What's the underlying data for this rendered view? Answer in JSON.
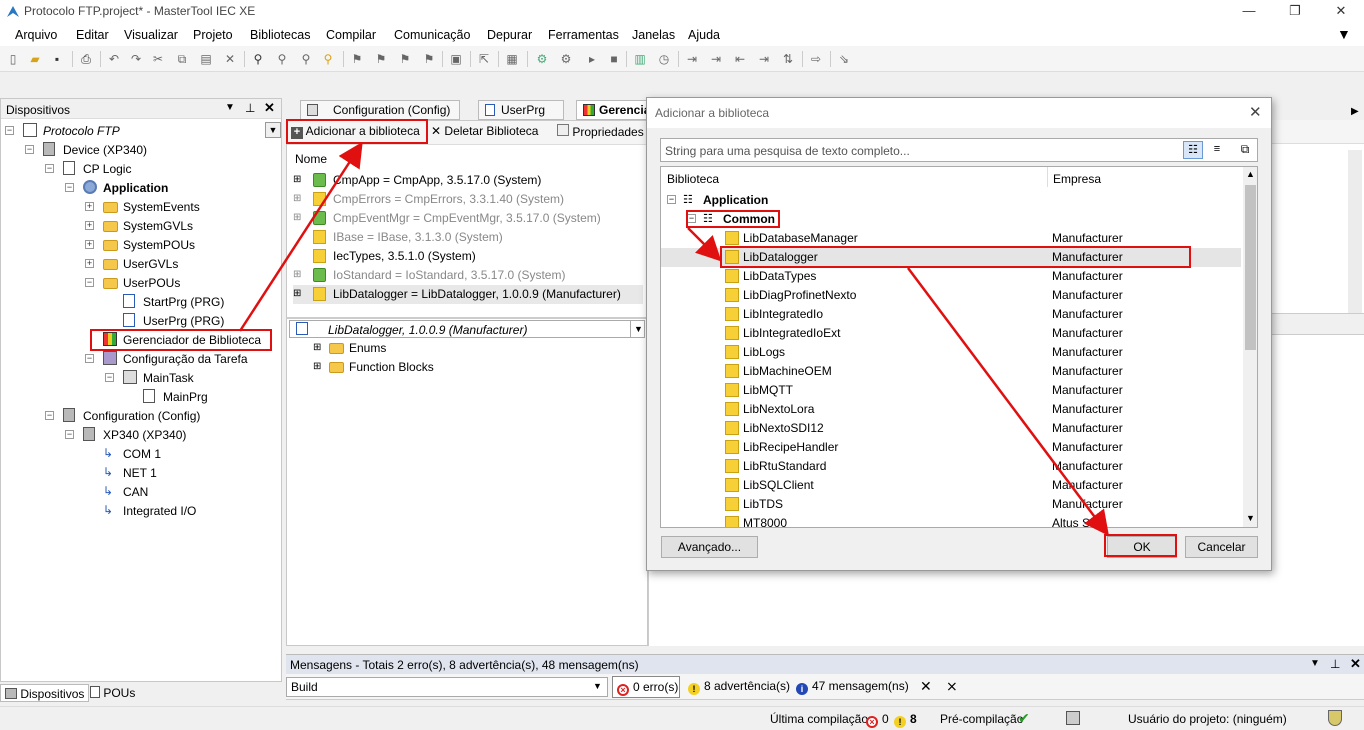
{
  "window": {
    "title": "Protocolo FTP.project* - MasterTool IEC XE",
    "controls": [
      "—",
      "❐",
      "✕"
    ]
  },
  "menu": [
    "Arquivo",
    "Editar",
    "Visualizar",
    "Projeto",
    "Bibliotecas",
    "Compilar",
    "Comunicação",
    "Depurar",
    "Ferramentas",
    "Janelas",
    "Ajuda"
  ],
  "left_panel": {
    "title": "Dispositivos",
    "tree": [
      {
        "label": "Protocolo FTP",
        "italic": true
      },
      {
        "label": "Device (XP340)"
      },
      {
        "label": "CP Logic"
      },
      {
        "label": "Application",
        "bold": true
      },
      {
        "label": "SystemEvents"
      },
      {
        "label": "SystemGVLs"
      },
      {
        "label": "SystemPOUs"
      },
      {
        "label": "UserGVLs"
      },
      {
        "label": "UserPOUs"
      },
      {
        "label": "StartPrg (PRG)"
      },
      {
        "label": "UserPrg (PRG)"
      },
      {
        "label": "Gerenciador de Biblioteca"
      },
      {
        "label": "Configuração da Tarefa"
      },
      {
        "label": "MainTask"
      },
      {
        "label": "MainPrg"
      },
      {
        "label": "Configuration (Config)"
      },
      {
        "label": "XP340 (XP340)"
      },
      {
        "label": "COM 1"
      },
      {
        "label": "NET 1"
      },
      {
        "label": "CAN"
      },
      {
        "label": "Integrated I/O"
      }
    ],
    "tabs": [
      "Dispositivos",
      "POUs"
    ]
  },
  "editor": {
    "tabs": [
      "Configuration (Config)",
      "UserPrg",
      "Gerencia"
    ],
    "toolbar": {
      "add": "Adicionar a biblioteca",
      "delete": "Deletar Biblioteca",
      "props": "Propriedades"
    },
    "column": "Nome",
    "libraries": [
      {
        "label": "CmpApp = CmpApp, 3.5.17.0 (System)",
        "gray": false
      },
      {
        "label": "CmpErrors = CmpErrors, 3.3.1.40 (System)",
        "gray": true
      },
      {
        "label": "CmpEventMgr = CmpEventMgr, 3.5.17.0 (System)",
        "gray": true
      },
      {
        "label": "IBase = IBase, 3.1.3.0 (System)",
        "gray": true
      },
      {
        "label": "IecTypes, 3.5.1.0 (System)",
        "gray": false
      },
      {
        "label": "IoStandard = IoStandard, 3.5.17.0 (System)",
        "gray": true
      },
      {
        "label": "LibDatalogger = LibDatalogger, 1.0.0.9 (Manufacturer)",
        "gray": false
      }
    ],
    "detail_title": "LibDatalogger, 1.0.0.9 (Manufacturer)",
    "detail_items": [
      "Enums",
      "Function Blocks"
    ]
  },
  "dialog": {
    "title": "Adicionar a biblioteca",
    "search_placeholder": "String para uma pesquisa de texto completo...",
    "col_library": "Biblioteca",
    "col_company": "Empresa",
    "root": "Application",
    "group": "Common",
    "items": [
      {
        "name": "LibDatabaseManager",
        "company": "Manufacturer"
      },
      {
        "name": "LibDatalogger",
        "company": "Manufacturer",
        "selected": true
      },
      {
        "name": "LibDataTypes",
        "company": "Manufacturer"
      },
      {
        "name": "LibDiagProfinetNexto",
        "company": "Manufacturer"
      },
      {
        "name": "LibIntegratedIo",
        "company": "Manufacturer"
      },
      {
        "name": "LibIntegratedIoExt",
        "company": "Manufacturer"
      },
      {
        "name": "LibLogs",
        "company": "Manufacturer"
      },
      {
        "name": "LibMachineOEM",
        "company": "Manufacturer"
      },
      {
        "name": "LibMQTT",
        "company": "Manufacturer"
      },
      {
        "name": "LibNextoLora",
        "company": "Manufacturer"
      },
      {
        "name": "LibNextoSDI12",
        "company": "Manufacturer"
      },
      {
        "name": "LibRecipeHandler",
        "company": "Manufacturer"
      },
      {
        "name": "LibRtuStandard",
        "company": "Manufacturer"
      },
      {
        "name": "LibSQLClient",
        "company": "Manufacturer"
      },
      {
        "name": "LibTDS",
        "company": "Manufacturer"
      },
      {
        "name": "MT8000",
        "company": "Altus S.A."
      }
    ],
    "advanced": "Avançado...",
    "ok": "OK",
    "cancel": "Cancelar"
  },
  "messages": {
    "title": "Mensagens - Totais 2 erro(s), 8 advertência(s), 48 mensagem(ns)",
    "source": "Build",
    "errors": "0 erro(s)",
    "warnings": "8 advertência(s)",
    "infos": "47 mensagem(ns)"
  },
  "status": {
    "last_build": "Última compilação:",
    "err_count": "0",
    "warn_count": "8",
    "precompile": "Pré-compilação",
    "user": "Usuário do projeto: (ninguém)"
  },
  "colors": {
    "highlight_red": "#e01010",
    "folder": "#f5c84c",
    "lib_icon": "#f7d038"
  }
}
